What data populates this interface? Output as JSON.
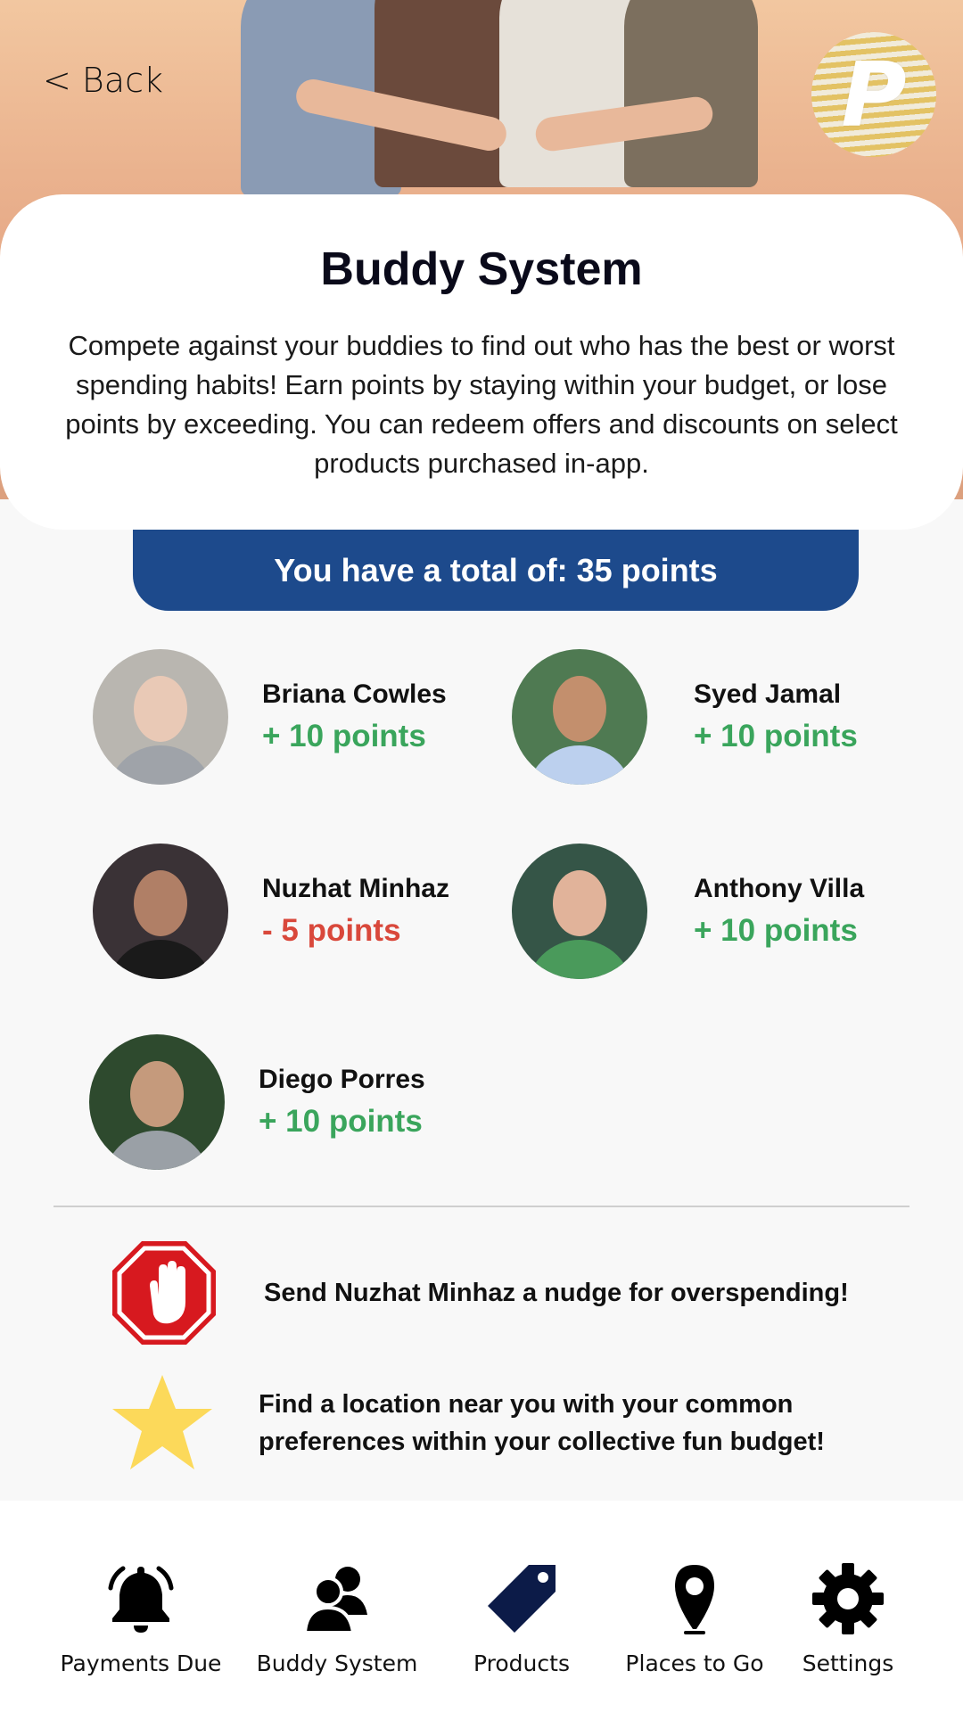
{
  "header": {
    "back_label": "< Back"
  },
  "logo": {
    "letter": "P"
  },
  "intro": {
    "title": "Buddy System",
    "description": "Compete against your buddies to find out who has the best or worst spending habits! Earn points by staying within your budget, or lose points by exceeding. You can redeem offers and discounts on select products purchased in-app."
  },
  "points_banner": "You have a total of: 35 points",
  "buddies": [
    {
      "name": "Briana Cowles",
      "points": "+ 10 points",
      "status": "positive"
    },
    {
      "name": "Syed Jamal",
      "points": "+ 10 points",
      "status": "positive"
    },
    {
      "name": "Nuzhat Minhaz",
      "points": "- 5 points",
      "status": "negative"
    },
    {
      "name": "Anthony Villa",
      "points": "+ 10 points",
      "status": "positive"
    },
    {
      "name": "Diego Porres",
      "points": "+ 10 points",
      "status": "positive"
    }
  ],
  "actions": [
    {
      "icon": "stop-hand-icon",
      "text": "Send Nuzhat Minhaz a nudge for overspending!"
    },
    {
      "icon": "star-icon",
      "text": "Find a location near you with your common preferences within your collective fun budget!"
    }
  ],
  "nav": [
    {
      "icon": "bell-icon",
      "label": "Payments Due"
    },
    {
      "icon": "users-icon",
      "label": "Buddy System"
    },
    {
      "icon": "tag-icon",
      "label": "Products"
    },
    {
      "icon": "map-pin-icon",
      "label": "Places to Go"
    },
    {
      "icon": "gear-icon",
      "label": "Settings"
    }
  ],
  "colors": {
    "primary_blue": "#1d4a8c",
    "positive_green": "#3aa55c",
    "negative_red": "#d9483b",
    "stop_red": "#d7191f",
    "star_yellow": "#fcd95a"
  }
}
